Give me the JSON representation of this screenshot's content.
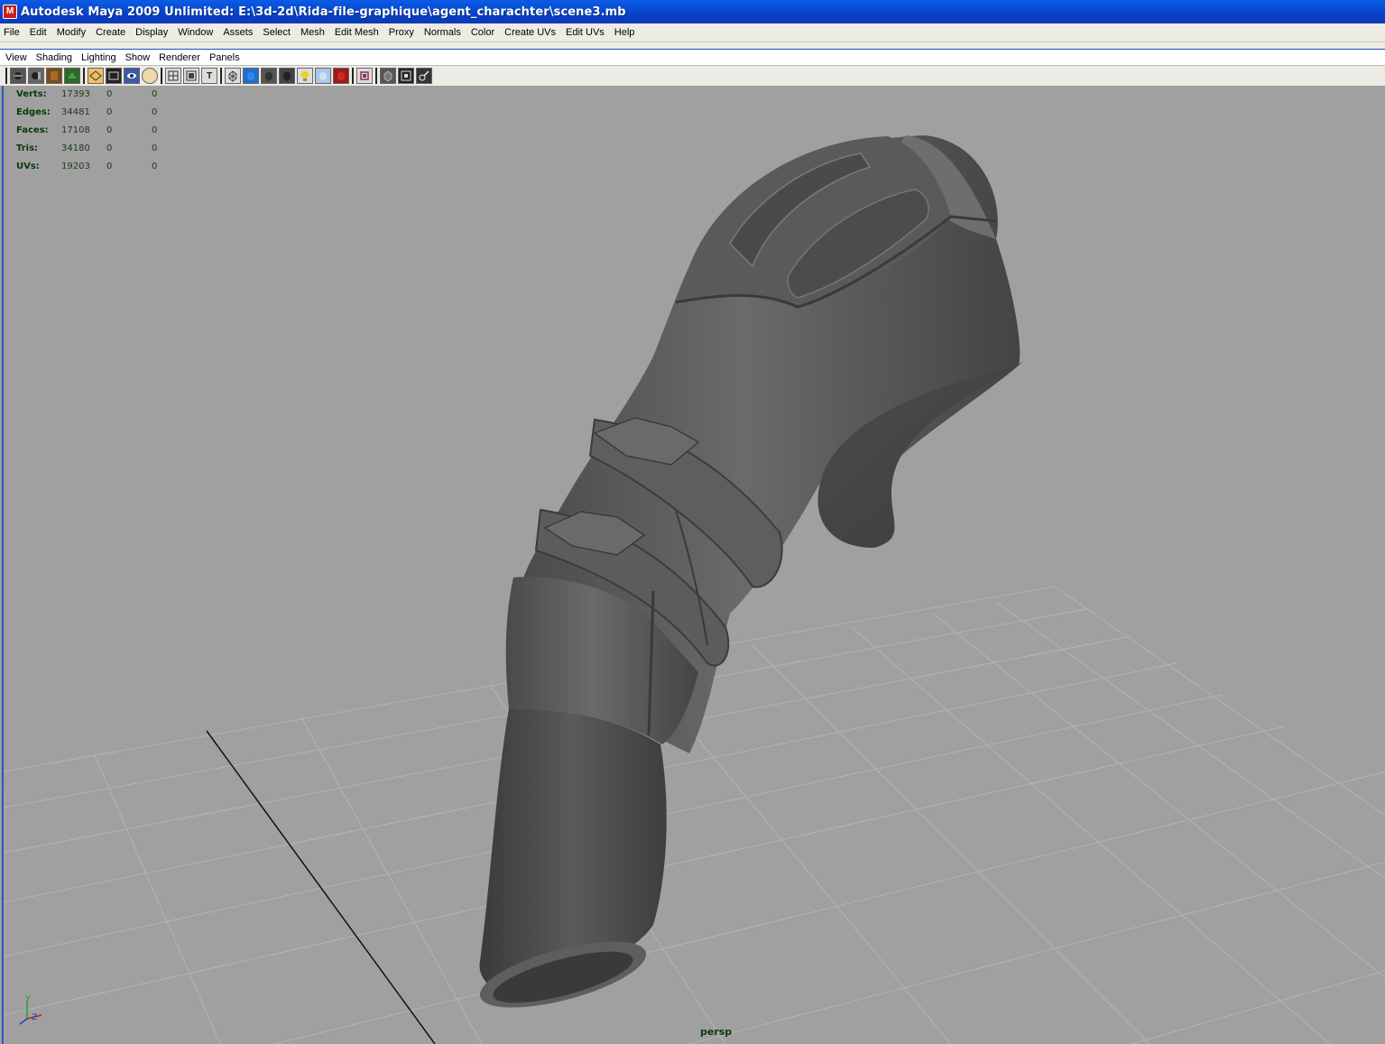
{
  "window": {
    "title": "Autodesk Maya 2009 Unlimited: E:\\3d-2d\\Rida-file-graphique\\agent_charachter\\scene3.mb"
  },
  "menu": [
    "File",
    "Edit",
    "Modify",
    "Create",
    "Display",
    "Window",
    "Assets",
    "Select",
    "Mesh",
    "Edit Mesh",
    "Proxy",
    "Normals",
    "Color",
    "Create UVs",
    "Edit UVs",
    "Help"
  ],
  "panel_menu": [
    "View",
    "Shading",
    "Lighting",
    "Show",
    "Renderer",
    "Panels"
  ],
  "toolbar_icons": [
    "camera-select-icon",
    "camera-attributes-icon",
    "bookmark-icon",
    "image-plane-icon",
    "grid-toggle-icon",
    "film-gate-icon",
    "resolution-gate-icon",
    "gate-mask-icon",
    "field-chart-icon",
    "safe-action-icon",
    "safe-title-icon",
    "wireframe-icon",
    "smooth-shade-icon",
    "flat-shade-icon",
    "bounding-box-icon",
    "use-lights-icon",
    "shadows-icon",
    "textures-icon",
    "xray-icon",
    "isolate-icon",
    "frame-all-icon",
    "frame-selected-icon",
    "hud-icon"
  ],
  "hud": {
    "rows": [
      {
        "label": "Verts:",
        "c1": "17393",
        "c2": "0",
        "c3": "0"
      },
      {
        "label": "Edges:",
        "c1": "34481",
        "c2": "0",
        "c3": "0"
      },
      {
        "label": "Faces:",
        "c1": "17108",
        "c2": "0",
        "c3": "0"
      },
      {
        "label": "Tris:",
        "c1": "34180",
        "c2": "0",
        "c3": "0"
      },
      {
        "label": "UVs:",
        "c1": "19203",
        "c2": "0",
        "c3": "0"
      }
    ]
  },
  "viewport": {
    "camera": "persp",
    "axis_y": "Y",
    "axis_z": "Z"
  },
  "colors": {
    "title_bar": "#0842c8",
    "viewport_bg": "#a0a0a0",
    "mesh": "#555555",
    "hud_text": "#0b3d0b"
  }
}
